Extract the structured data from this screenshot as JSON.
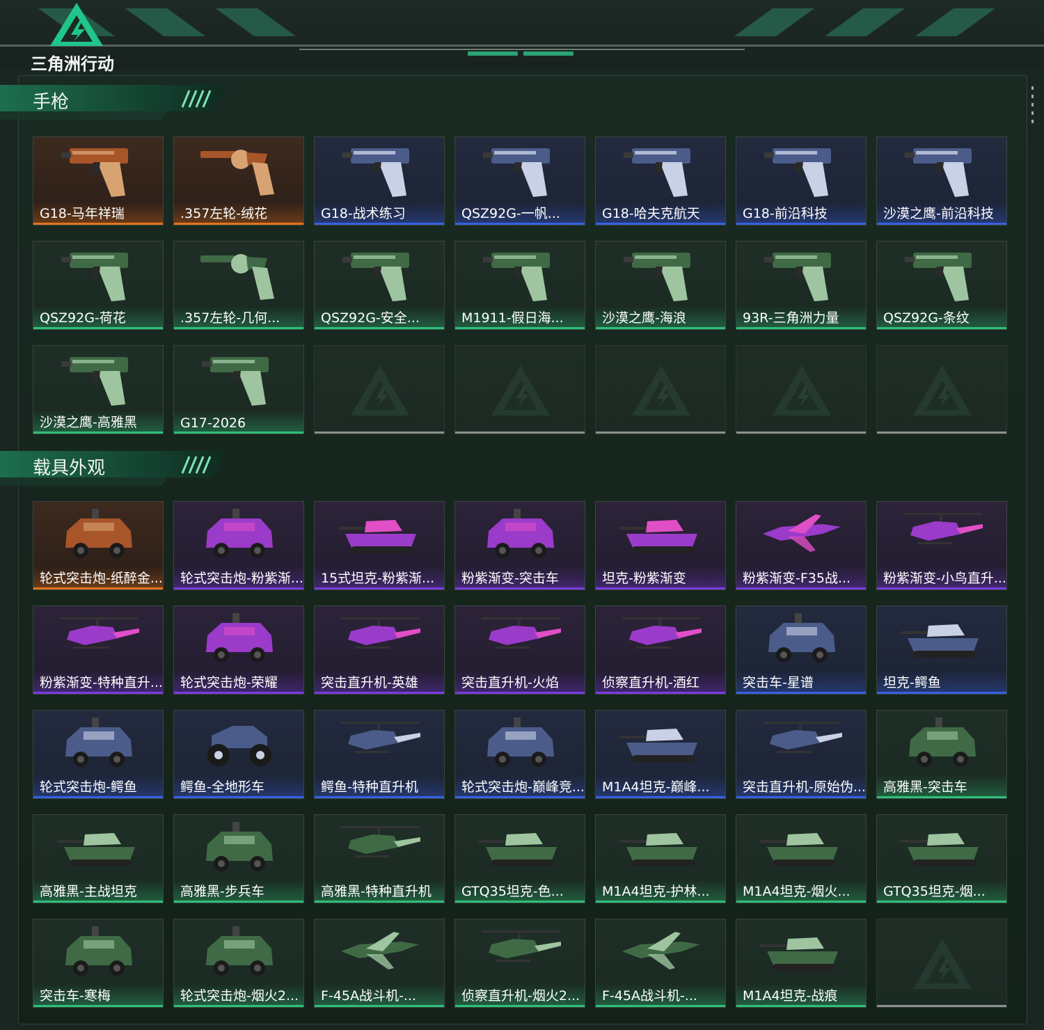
{
  "app": {
    "logo_text": "三角洲行动"
  },
  "colors": {
    "orange": "#e2741e",
    "blue": "#3561e0",
    "purple": "#7a3be0",
    "green": "#2fbf79",
    "gray": "#8a918e"
  },
  "sections": [
    {
      "title": "手枪",
      "items": [
        {
          "name": "G18-马年祥瑞",
          "rarity": "orange",
          "icon": "pistol"
        },
        {
          "name": ".357左轮-绒花",
          "rarity": "orange",
          "icon": "revolver"
        },
        {
          "name": "G18-战术练习",
          "rarity": "blue",
          "icon": "pistol"
        },
        {
          "name": "QSZ92G-一帆...",
          "rarity": "blue",
          "icon": "pistol"
        },
        {
          "name": "G18-哈夫克航天",
          "rarity": "blue",
          "icon": "pistol"
        },
        {
          "name": "G18-前沿科技",
          "rarity": "blue",
          "icon": "pistol"
        },
        {
          "name": "沙漠之鹰-前沿科技",
          "rarity": "blue",
          "icon": "pistol"
        },
        {
          "name": "QSZ92G-荷花",
          "rarity": "green",
          "icon": "pistol"
        },
        {
          "name": ".357左轮-几何...",
          "rarity": "green",
          "icon": "revolver"
        },
        {
          "name": "QSZ92G-安全...",
          "rarity": "green",
          "icon": "pistol"
        },
        {
          "name": "M1911-假日海...",
          "rarity": "green",
          "icon": "pistol"
        },
        {
          "name": "沙漠之鹰-海浪",
          "rarity": "green",
          "icon": "pistol"
        },
        {
          "name": "93R-三角洲力量",
          "rarity": "green",
          "icon": "pistol"
        },
        {
          "name": "QSZ92G-条纹",
          "rarity": "green",
          "icon": "pistol"
        },
        {
          "name": "沙漠之鹰-高雅黑",
          "rarity": "green",
          "icon": "pistol"
        },
        {
          "name": "G17-2026",
          "rarity": "green",
          "icon": "pistol"
        }
      ],
      "empty_slots": 5
    },
    {
      "title": "载具外观",
      "items": [
        {
          "name": "轮式突击炮-纸醉金...",
          "rarity": "orange",
          "icon": "armored-car"
        },
        {
          "name": "轮式突击炮-粉紫渐...",
          "rarity": "purple",
          "icon": "armored-car"
        },
        {
          "name": "15式坦克-粉紫渐...",
          "rarity": "purple",
          "icon": "tank"
        },
        {
          "name": "粉紫渐变-突击车",
          "rarity": "purple",
          "icon": "armored-car"
        },
        {
          "name": "坦克-粉紫渐变",
          "rarity": "purple",
          "icon": "tank"
        },
        {
          "name": "粉紫渐变-F35战...",
          "rarity": "purple",
          "icon": "jet"
        },
        {
          "name": "粉紫渐变-小鸟直升...",
          "rarity": "purple",
          "icon": "helicopter"
        },
        {
          "name": "粉紫渐变-特种直升...",
          "rarity": "purple",
          "icon": "helicopter"
        },
        {
          "name": "轮式突击炮-荣耀",
          "rarity": "purple",
          "icon": "armored-car"
        },
        {
          "name": "突击直升机-英雄",
          "rarity": "purple",
          "icon": "helicopter"
        },
        {
          "name": "突击直升机-火焰",
          "rarity": "purple",
          "icon": "helicopter"
        },
        {
          "name": "侦察直升机-酒红",
          "rarity": "purple",
          "icon": "helicopter"
        },
        {
          "name": "突击车-星谱",
          "rarity": "blue",
          "icon": "armored-car"
        },
        {
          "name": "坦克-鳄鱼",
          "rarity": "blue",
          "icon": "tank"
        },
        {
          "name": "轮式突击炮-鳄鱼",
          "rarity": "blue",
          "icon": "armored-car"
        },
        {
          "name": "鳄鱼-全地形车",
          "rarity": "blue",
          "icon": "atv"
        },
        {
          "name": "鳄鱼-特种直升机",
          "rarity": "blue",
          "icon": "helicopter"
        },
        {
          "name": "轮式突击炮-巅峰竞...",
          "rarity": "blue",
          "icon": "armored-car"
        },
        {
          "name": "M1A4坦克-巅峰...",
          "rarity": "blue",
          "icon": "tank"
        },
        {
          "name": "突击直升机-原始伪...",
          "rarity": "blue",
          "icon": "helicopter"
        },
        {
          "name": "高雅黑-突击车",
          "rarity": "green",
          "icon": "armored-car"
        },
        {
          "name": "高雅黑-主战坦克",
          "rarity": "green",
          "icon": "tank"
        },
        {
          "name": "高雅黑-步兵车",
          "rarity": "green",
          "icon": "armored-car"
        },
        {
          "name": "高雅黑-特种直升机",
          "rarity": "green",
          "icon": "helicopter"
        },
        {
          "name": "GTQ35坦克-色...",
          "rarity": "green",
          "icon": "tank"
        },
        {
          "name": "M1A4坦克-护林...",
          "rarity": "green",
          "icon": "tank"
        },
        {
          "name": "M1A4坦克-烟火...",
          "rarity": "green",
          "icon": "tank"
        },
        {
          "name": "GTQ35坦克-烟...",
          "rarity": "green",
          "icon": "tank"
        },
        {
          "name": "突击车-寒梅",
          "rarity": "green",
          "icon": "armored-car"
        },
        {
          "name": "轮式突击炮-烟火2...",
          "rarity": "green",
          "icon": "armored-car"
        },
        {
          "name": "F-45A战斗机-...",
          "rarity": "green",
          "icon": "jet"
        },
        {
          "name": "侦察直升机-烟火2...",
          "rarity": "green",
          "icon": "helicopter"
        },
        {
          "name": "F-45A战斗机-...",
          "rarity": "green",
          "icon": "jet"
        },
        {
          "name": "M1A4坦克-战痕",
          "rarity": "green",
          "icon": "tank"
        }
      ],
      "empty_slots": 1
    }
  ]
}
